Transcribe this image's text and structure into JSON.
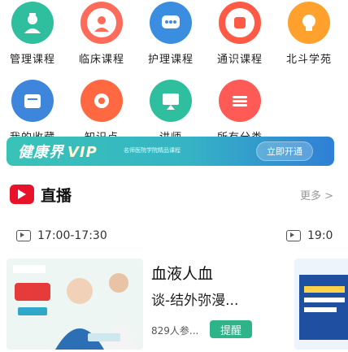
{
  "grid": {
    "items": [
      {
        "label": "管理课程",
        "icon": "nurse-icon",
        "color": "#2fbf9f"
      },
      {
        "label": "临床课程",
        "icon": "doctor-icon",
        "color": "#ff6b5a"
      },
      {
        "label": "护理课程",
        "icon": "chat-bubble-icon",
        "color": "#3a8ddf"
      },
      {
        "label": "通识课程",
        "icon": "record-icon",
        "color": "#ff5a46"
      },
      {
        "label": "北斗学苑",
        "icon": "bulb-icon",
        "color": "#ffa12c"
      },
      {
        "label": "我的收藏",
        "icon": "folder-icon",
        "color": "#3d86db"
      },
      {
        "label": "知识点",
        "icon": "gear-icon",
        "color": "#ff6840"
      },
      {
        "label": "讲师",
        "icon": "teacher-icon",
        "color": "#2fbf9f"
      },
      {
        "label": "所有分类",
        "icon": "category-icon",
        "color": "#ff5a55"
      }
    ]
  },
  "vip": {
    "title": "健康界",
    "badge": "VIP",
    "subtitle": "名师医院学院精品课程",
    "button": "立即开通"
  },
  "live": {
    "title": "直播",
    "more": "更多",
    "times": [
      "17:00-17:30",
      "19:0"
    ],
    "card": {
      "title": "血液人血",
      "teacher": "谈-结外弥漫...",
      "viewers": "829人参...",
      "remind": "提醒"
    }
  }
}
